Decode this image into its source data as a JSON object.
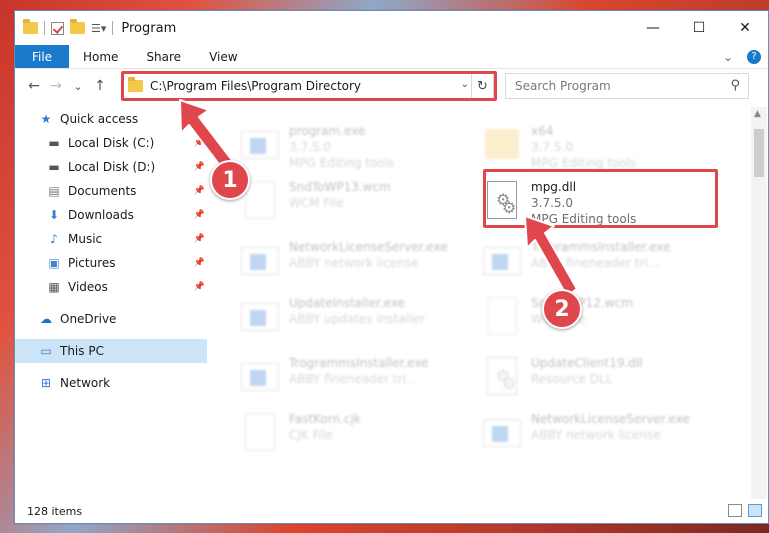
{
  "window": {
    "title": "Program",
    "controls": {
      "minimize": "—",
      "maximize": "☐",
      "close": "✕"
    }
  },
  "ribbon": {
    "file": "File",
    "tabs": [
      "Home",
      "Share",
      "View"
    ]
  },
  "nav": {
    "back": "←",
    "forward": "→",
    "recent": "⌄",
    "up": "↑",
    "address": "C:\\Program Files\\Program Directory",
    "search_placeholder": "Search Program"
  },
  "sidebar": [
    {
      "label": "Quick access",
      "icon": "star-icon",
      "pinned": false,
      "selected": false
    },
    {
      "label": "Local Disk (C:)",
      "icon": "drive-icon",
      "pinned": true,
      "selected": false
    },
    {
      "label": "Local Disk (D:)",
      "icon": "drive-icon",
      "pinned": true,
      "selected": false
    },
    {
      "label": "Documents",
      "icon": "documents-icon",
      "pinned": true,
      "selected": false
    },
    {
      "label": "Downloads",
      "icon": "download-icon",
      "pinned": true,
      "selected": false
    },
    {
      "label": "Music",
      "icon": "music-icon",
      "pinned": true,
      "selected": false
    },
    {
      "label": "Pictures",
      "icon": "pictures-icon",
      "pinned": true,
      "selected": false
    },
    {
      "label": "Videos",
      "icon": "videos-icon",
      "pinned": true,
      "selected": false
    },
    {
      "label": "OneDrive",
      "icon": "cloud-icon",
      "pinned": false,
      "selected": false
    },
    {
      "label": "This PC",
      "icon": "computer-icon",
      "pinned": false,
      "selected": true
    },
    {
      "label": "Network",
      "icon": "network-icon",
      "pinned": false,
      "selected": false
    }
  ],
  "files": [
    {
      "name": "program.exe",
      "line2": "3.7.5.0",
      "line3": "MPG Editing tools",
      "type": "exe-icon",
      "highlight": false
    },
    {
      "name": "x64",
      "line2": "3.7.5.0",
      "line3": "MPG Editing tools",
      "type": "folder-icon",
      "highlight": false
    },
    {
      "name": "SndToWP13.wcm",
      "line2": "WCM File",
      "line3": "",
      "type": "page-icon",
      "highlight": false
    },
    {
      "name": "mpg.dll",
      "line2": "3.7.5.0",
      "line3": "MPG Editing tools",
      "type": "dll-icon",
      "highlight": true
    },
    {
      "name": "NetworkLicenseServer.exe",
      "line2": "ABBY network license",
      "line3": "",
      "type": "exe-icon",
      "highlight": false
    },
    {
      "name": "TrogrammsInstaller.exe",
      "line2": "ABBY fineneader tri...",
      "line3": "",
      "type": "exe-icon",
      "highlight": false
    },
    {
      "name": "UpdateInstaller.exe",
      "line2": "ABBY updates installer",
      "line3": "",
      "type": "exe-icon",
      "highlight": false
    },
    {
      "name": "SndToWP12.wcm",
      "line2": "WCM File",
      "line3": "",
      "type": "page-icon",
      "highlight": false
    },
    {
      "name": "TrogrammsInstaller.exe",
      "line2": "ABBY fineneader tri...",
      "line3": "",
      "type": "exe-icon",
      "highlight": false
    },
    {
      "name": "UpdateClient19.dll",
      "line2": "Resource DLL",
      "line3": "",
      "type": "dll-icon",
      "highlight": false
    },
    {
      "name": "FastKorn.cjk",
      "line2": "CJK File",
      "line3": "",
      "type": "page-icon",
      "highlight": false
    },
    {
      "name": "NetworkLicenseServer.exe",
      "line2": "ABBY network license",
      "line3": "",
      "type": "exe-icon",
      "highlight": false
    }
  ],
  "status": {
    "count": "128 items"
  },
  "annotations": {
    "step1": "1",
    "step2": "2",
    "color": "#e0474c"
  }
}
